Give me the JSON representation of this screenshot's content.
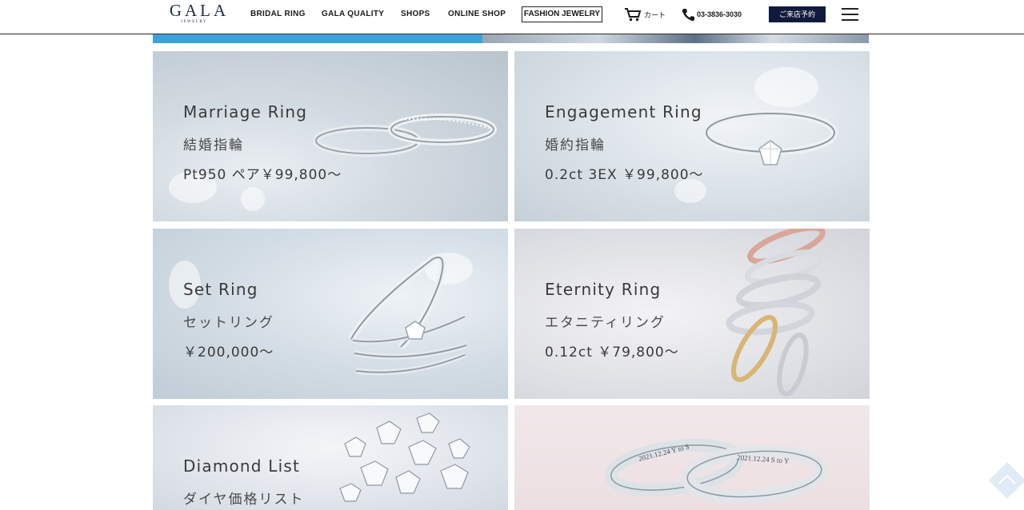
{
  "header": {
    "logo_main": "GALA",
    "logo_sub": "JEWELRY",
    "nav": [
      {
        "label": "BRIDAL RING"
      },
      {
        "label": "GALA QUALITY"
      },
      {
        "label": "SHOPS"
      },
      {
        "label": "ONLINE SHOP"
      }
    ],
    "fashion_label": "FASHION JEWELRY",
    "cart_label": "カート",
    "cart_icon": "cart-icon",
    "phone_label": "03-3836-3030",
    "phone_icon": "phone-icon",
    "reserve_label": "ご来店予約",
    "menu_icon": "hamburger-menu-icon"
  },
  "banner": {
    "accent_color": "#3da2dc"
  },
  "cards": {
    "marriage": {
      "title": "Marriage Ring",
      "ja": "結婚指輪",
      "price": "Pt950 ペア￥99,800〜"
    },
    "engagement": {
      "title": "Engagement Ring",
      "ja": "婚約指輪",
      "price": "0.2ct 3EX ￥99,800〜"
    },
    "set": {
      "title": "Set Ring",
      "ja": "セットリング",
      "price": "￥200,000〜"
    },
    "eternity": {
      "title": "Eternity Ring",
      "ja": "エタニティリング",
      "price": "0.12ct ￥79,800〜"
    },
    "diamond": {
      "title": "Diamond List",
      "ja": "ダイヤ価格リスト"
    },
    "engrave": {
      "engraving_1": "2021.12.24 Y to S",
      "engraving_2": "2021.12.24 S to Y"
    }
  },
  "to_top_icon": "scroll-to-top-icon"
}
